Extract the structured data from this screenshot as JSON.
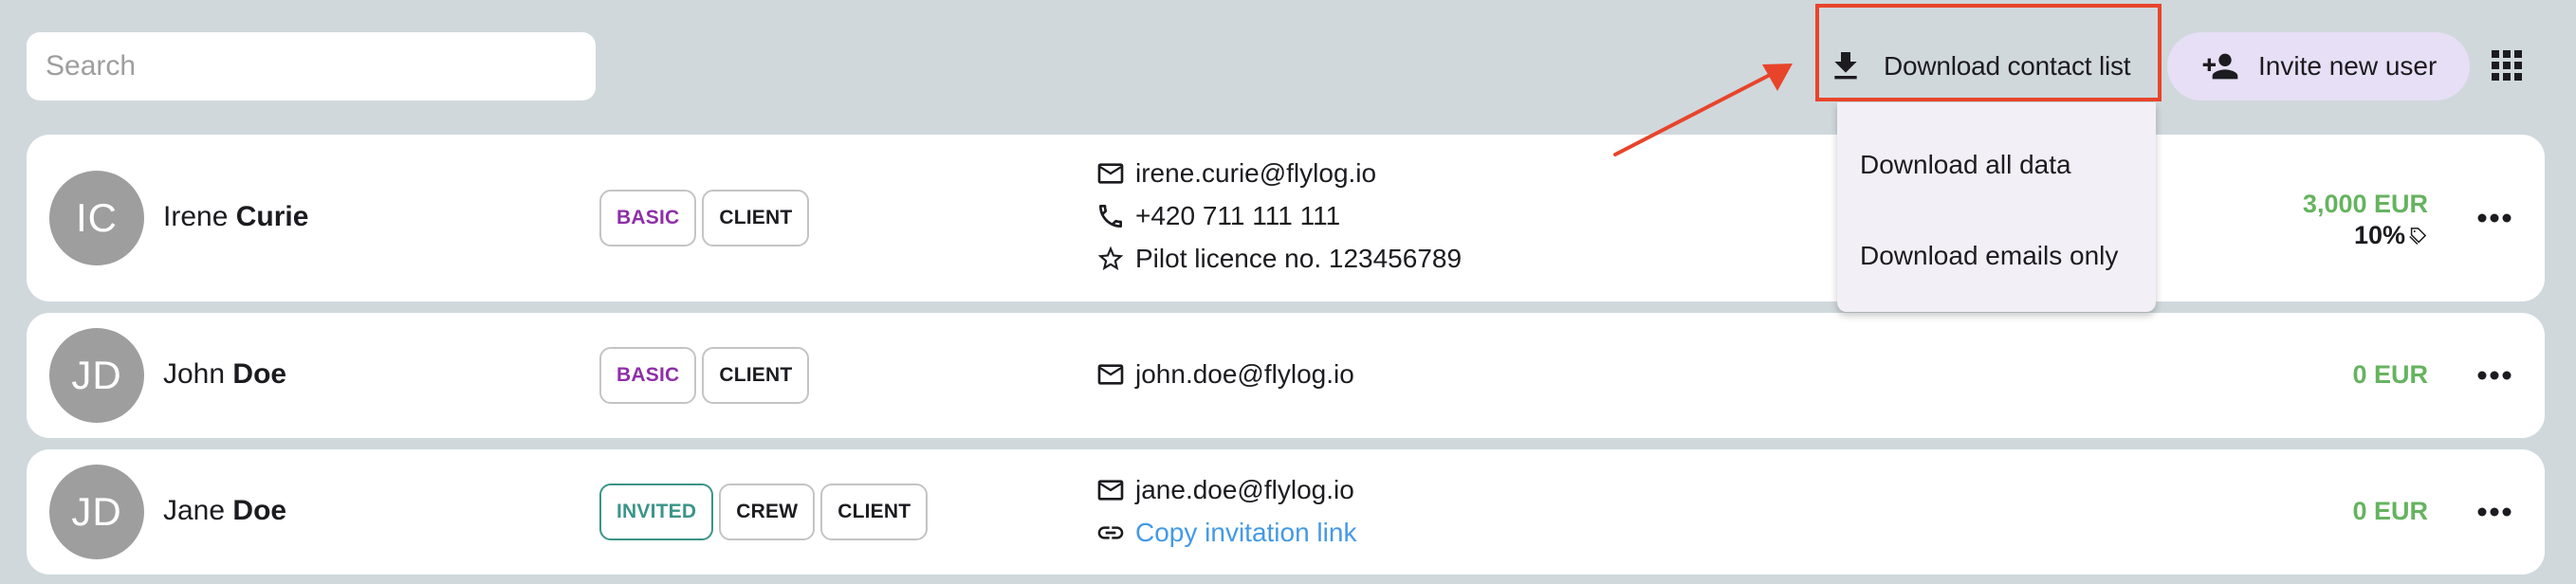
{
  "search": {
    "placeholder": "Search",
    "value": ""
  },
  "toolbar": {
    "download_label": "Download contact list",
    "invite_label": "Invite new user",
    "download_icon": "download-icon",
    "invite_icon": "person-add-icon",
    "apps_icon": "grid-icon"
  },
  "download_menu": {
    "items": [
      {
        "label": "Download all data"
      },
      {
        "label": "Download emails only"
      }
    ]
  },
  "annotation": {
    "highlight_color": "#e8442b",
    "target": "download-contact-list-button"
  },
  "colors": {
    "background": "#d0d8dc",
    "price_green": "#66b35f",
    "badge_basic": "#8e2fa8",
    "badge_invited": "#3c9488",
    "link_blue": "#4499e6",
    "invite_button_bg": "#e6dff5",
    "menu_bg": "#f2eff6"
  },
  "users": [
    {
      "initials": "IC",
      "first_name": "Irene",
      "last_name": "Curie",
      "badges": [
        {
          "label": "BASIC",
          "kind": "basic"
        },
        {
          "label": "CLIENT",
          "kind": "plain"
        }
      ],
      "contacts": [
        {
          "icon": "mail-icon",
          "text": "irene.curie@flylog.io"
        },
        {
          "icon": "phone-icon",
          "text": "+420 711 111 111"
        },
        {
          "icon": "star-icon",
          "text": "Pilot licence no. 123456789"
        }
      ],
      "price": "3,000 EUR",
      "discount": "10%",
      "discount_icon": "tag-icon"
    },
    {
      "initials": "JD",
      "first_name": "John",
      "last_name": "Doe",
      "badges": [
        {
          "label": "BASIC",
          "kind": "basic"
        },
        {
          "label": "CLIENT",
          "kind": "plain"
        }
      ],
      "contacts": [
        {
          "icon": "mail-icon",
          "text": "john.doe@flylog.io"
        }
      ],
      "price": "0 EUR"
    },
    {
      "initials": "JD",
      "first_name": "Jane",
      "last_name": "Doe",
      "badges": [
        {
          "label": "INVITED",
          "kind": "invited"
        },
        {
          "label": "CREW",
          "kind": "plain"
        },
        {
          "label": "CLIENT",
          "kind": "plain"
        }
      ],
      "contacts": [
        {
          "icon": "mail-icon",
          "text": "jane.doe@flylog.io"
        },
        {
          "icon": "link-icon",
          "text": "Copy invitation link",
          "link": true
        }
      ],
      "price": "0 EUR"
    }
  ]
}
